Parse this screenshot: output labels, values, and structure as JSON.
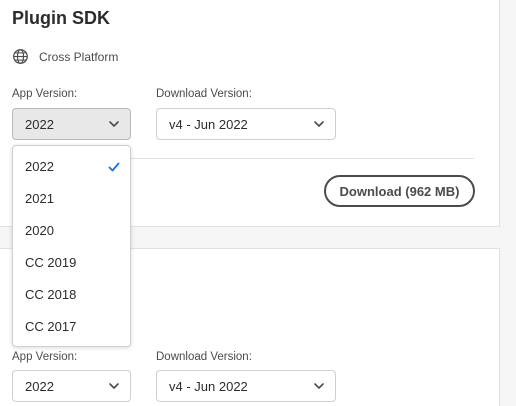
{
  "plugin": {
    "title": "Plugin SDK",
    "platform": "Cross Platform",
    "app_version_label": "App Version:",
    "app_version_value": "2022",
    "download_version_label": "Download Version:",
    "download_version_value": "v4 - Jun 2022",
    "download_button": "Download (962 MB)"
  },
  "dropdown": {
    "items": [
      {
        "label": "2022",
        "selected": true
      },
      {
        "label": "2021"
      },
      {
        "label": "2020"
      },
      {
        "label": "CC 2019"
      },
      {
        "label": "CC 2018"
      },
      {
        "label": "CC 2017"
      }
    ]
  },
  "second_card": {
    "app_version_label": "App Version:",
    "app_version_value": "2022",
    "download_version_label": "Download Version:",
    "download_version_value": "v4 - Jun 2022"
  },
  "colors": {
    "accent": "#1473e6",
    "text": "#2c2c2c",
    "border": "#cfcfcf"
  },
  "icons": {
    "platform": "globe-icon",
    "select": "chevron-down-icon",
    "selected": "checkmark-icon"
  }
}
